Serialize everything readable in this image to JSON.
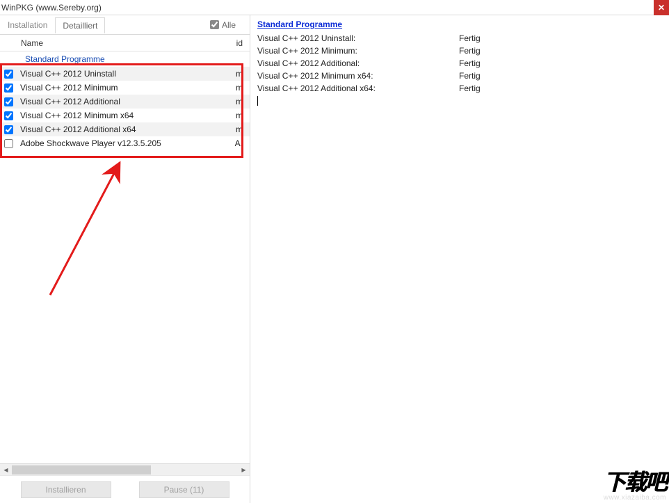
{
  "window": {
    "title": "WinPKG (www.Sereby.org)"
  },
  "tabs": {
    "installation": "Installation",
    "detailliert": "Detailliert"
  },
  "alle": {
    "label": "Alle",
    "checked": true
  },
  "list": {
    "header_name": "Name",
    "header_id": "id",
    "group": "Standard Programme",
    "items": [
      {
        "checked": true,
        "name": "Visual C++ 2012 Uninstall",
        "id": "m"
      },
      {
        "checked": true,
        "name": "Visual C++ 2012 Minimum",
        "id": "m"
      },
      {
        "checked": true,
        "name": "Visual C++ 2012 Additional",
        "id": "m"
      },
      {
        "checked": true,
        "name": "Visual C++ 2012 Minimum x64",
        "id": "m"
      },
      {
        "checked": true,
        "name": "Visual C++ 2012 Additional x64",
        "id": "m"
      },
      {
        "checked": false,
        "name": "Adobe Shockwave Player v12.3.5.205",
        "id": "A."
      }
    ]
  },
  "buttons": {
    "install": "Installieren",
    "pause": "Pause (11)"
  },
  "log": {
    "header": "Standard Programme",
    "lines": [
      {
        "label": "Visual C++ 2012 Uninstall:",
        "status": "Fertig"
      },
      {
        "label": "Visual C++ 2012 Minimum:",
        "status": "Fertig"
      },
      {
        "label": "Visual C++ 2012 Additional:",
        "status": "Fertig"
      },
      {
        "label": "Visual C++ 2012 Minimum x64:",
        "status": "Fertig"
      },
      {
        "label": "Visual C++ 2012 Additional x64:",
        "status": "Fertig"
      }
    ]
  },
  "watermark": {
    "text": "下载吧",
    "url": "www.xiazaiba.com"
  },
  "icons": {
    "close": "✕",
    "left": "◀",
    "right": "▶"
  }
}
